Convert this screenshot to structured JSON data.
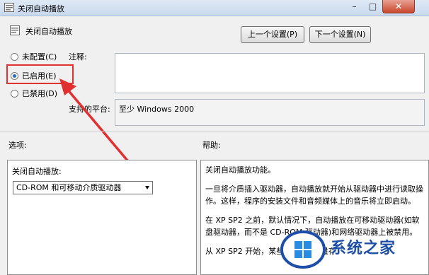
{
  "window": {
    "title": "关闭自动播放"
  },
  "header": {
    "title": "关闭自动播放"
  },
  "buttons": {
    "prev": "上一个设置(P)",
    "next": "下一个设置(N)"
  },
  "radios": [
    {
      "label": "未配置(C)",
      "selected": false
    },
    {
      "label": "已启用(E)",
      "selected": true
    },
    {
      "label": "已禁用(D)",
      "selected": false
    }
  ],
  "labels": {
    "comment": "注释:",
    "platform": "支持的平台:",
    "options": "选项:",
    "help": "帮助:"
  },
  "platform_value": "至少 Windows 2000",
  "options": {
    "label": "关闭自动播放:",
    "select_value": "CD-ROM 和可移动介质驱动器"
  },
  "help": [
    "关闭自动播放功能。",
    "一旦将介质插入驱动器，自动播放就开始从驱动器中进行读取操作。这样，程序的安装文件和音频媒体上的音乐将立即启动。",
    "在 XP SP2 之前，默认情况下，自动播放在可移动驱动器(如软盘驱动器，而不是 CD-ROM 驱动器)和网络驱动器上被禁用。",
    "从 XP SP2 开始，某些 USB 大容量存"
  ],
  "watermark": {
    "text": "系统之家"
  },
  "colors": {
    "highlight": "#e0302f",
    "accent": "#2b6ab8",
    "watermark": "#1e4fa8"
  }
}
